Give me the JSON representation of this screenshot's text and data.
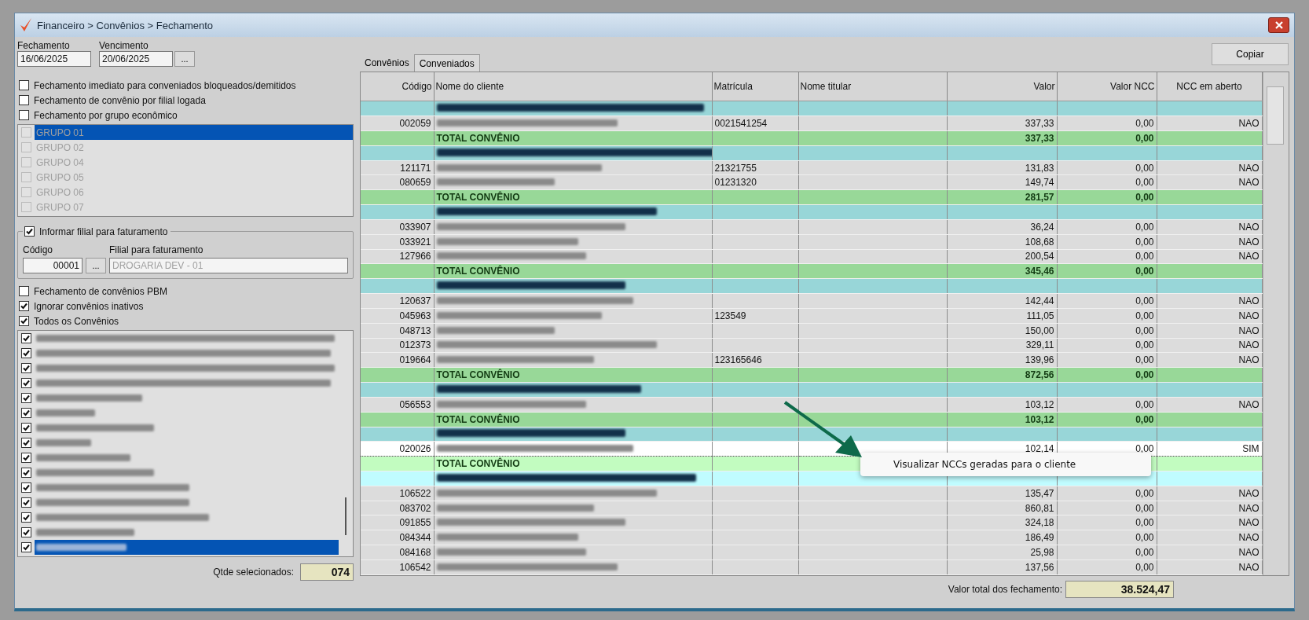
{
  "window": {
    "title": "Financeiro > Convênios > Fechamento"
  },
  "dates": {
    "fechamento_label": "Fechamento",
    "fechamento": "16/06/2025",
    "vencimento_label": "Vencimento",
    "vencimento": "20/06/2025",
    "picker": "..."
  },
  "options_top": [
    {
      "label": "Fechamento imediato para conveniados bloqueados/demitidos",
      "checked": false
    },
    {
      "label": "Fechamento de convênio por filial logada",
      "checked": false
    },
    {
      "label": "Fechamento por grupo econômico",
      "checked": false
    }
  ],
  "group_list": {
    "disabled": true,
    "items": [
      {
        "label": "GRUPO 01",
        "checked": false,
        "selected": true
      },
      {
        "label": "GRUPO 02",
        "checked": false,
        "selected": false
      },
      {
        "label": "GRUPO 04",
        "checked": false,
        "selected": false
      },
      {
        "label": "GRUPO 05",
        "checked": false,
        "selected": false
      },
      {
        "label": "GRUPO 06",
        "checked": false,
        "selected": false
      },
      {
        "label": "GRUPO 07",
        "checked": false,
        "selected": false
      }
    ]
  },
  "filial": {
    "label": "Informar filial para faturamento",
    "checked": true,
    "codigo_label": "Código",
    "codigo": "00001",
    "picker": "...",
    "filial_label": "Filial para faturamento",
    "filial": "DROGARIA DEV - 01"
  },
  "options_bottom": [
    {
      "label": "Fechamento de convênios PBM",
      "checked": false
    },
    {
      "label": "Ignorar convênios inativos",
      "checked": true
    },
    {
      "label": "Todos os Convênios",
      "checked": true
    }
  ],
  "convenios": [
    {
      "checked": true,
      "selected": false
    },
    {
      "checked": true,
      "selected": false
    },
    {
      "checked": true,
      "selected": false
    },
    {
      "checked": true,
      "selected": false
    },
    {
      "checked": true,
      "selected": false
    },
    {
      "checked": true,
      "selected": false
    },
    {
      "checked": true,
      "selected": false
    },
    {
      "checked": true,
      "selected": false
    },
    {
      "checked": true,
      "selected": false
    },
    {
      "checked": true,
      "selected": false
    },
    {
      "checked": true,
      "selected": false
    },
    {
      "checked": true,
      "selected": false
    },
    {
      "checked": true,
      "selected": false
    },
    {
      "checked": true,
      "selected": false
    },
    {
      "checked": true,
      "selected": true
    }
  ],
  "qtde": {
    "label": "Qtde selecionados:",
    "value": "074"
  },
  "tabs": [
    {
      "label": "Convênios",
      "selected": false
    },
    {
      "label": "Conveniados",
      "selected": true
    }
  ],
  "copy_button": "Copiar",
  "table": {
    "columns": [
      "Código",
      "Nome do cliente",
      "Matrícula",
      "Nome titular",
      "Valor",
      "Valor NCC",
      "NCC em aberto"
    ],
    "rows": [
      {
        "kind": "group",
        "highlighted": false
      },
      {
        "kind": "item",
        "codigo": "002059",
        "matricula": "0021541254",
        "valor": "337,33",
        "valor_ncc": "0,00",
        "ncc_aberto": "NAO",
        "selected": false
      },
      {
        "kind": "total",
        "label": "TOTAL CONVÊNIO",
        "valor": "337,33",
        "valor_ncc": "0,00",
        "highlighted": false
      },
      {
        "kind": "group",
        "highlighted": false
      },
      {
        "kind": "item",
        "codigo": "121171",
        "matricula": "21321755",
        "valor": "131,83",
        "valor_ncc": "0,00",
        "ncc_aberto": "NAO",
        "selected": false
      },
      {
        "kind": "item",
        "codigo": "080659",
        "matricula": "01231320",
        "valor": "149,74",
        "valor_ncc": "0,00",
        "ncc_aberto": "NAO",
        "selected": false
      },
      {
        "kind": "total",
        "label": "TOTAL CONVÊNIO",
        "valor": "281,57",
        "valor_ncc": "0,00",
        "highlighted": false
      },
      {
        "kind": "group",
        "highlighted": false
      },
      {
        "kind": "item",
        "codigo": "033907",
        "valor": "36,24",
        "valor_ncc": "0,00",
        "ncc_aberto": "NAO",
        "selected": false
      },
      {
        "kind": "item",
        "codigo": "033921",
        "valor": "108,68",
        "valor_ncc": "0,00",
        "ncc_aberto": "NAO",
        "selected": false
      },
      {
        "kind": "item",
        "codigo": "127966",
        "valor": "200,54",
        "valor_ncc": "0,00",
        "ncc_aberto": "NAO",
        "selected": false
      },
      {
        "kind": "total",
        "label": "TOTAL CONVÊNIO",
        "valor": "345,46",
        "valor_ncc": "0,00",
        "highlighted": false
      },
      {
        "kind": "group",
        "highlighted": false
      },
      {
        "kind": "item",
        "codigo": "120637",
        "valor": "142,44",
        "valor_ncc": "0,00",
        "ncc_aberto": "NAO",
        "selected": false
      },
      {
        "kind": "item",
        "codigo": "045963",
        "matricula": "123549",
        "valor": "111,05",
        "valor_ncc": "0,00",
        "ncc_aberto": "NAO",
        "selected": false
      },
      {
        "kind": "item",
        "codigo": "048713",
        "valor": "150,00",
        "valor_ncc": "0,00",
        "ncc_aberto": "NAO",
        "selected": false
      },
      {
        "kind": "item",
        "codigo": "012373",
        "valor": "329,11",
        "valor_ncc": "0,00",
        "ncc_aberto": "NAO",
        "selected": false
      },
      {
        "kind": "item",
        "codigo": "019664",
        "matricula": "123165646",
        "valor": "139,96",
        "valor_ncc": "0,00",
        "ncc_aberto": "NAO",
        "selected": false
      },
      {
        "kind": "total",
        "label": "TOTAL CONVÊNIO",
        "valor": "872,56",
        "valor_ncc": "0,00",
        "highlighted": false
      },
      {
        "kind": "group",
        "highlighted": false
      },
      {
        "kind": "item",
        "codigo": "056553",
        "valor": "103,12",
        "valor_ncc": "0,00",
        "ncc_aberto": "NAO",
        "selected": false
      },
      {
        "kind": "total",
        "label": "TOTAL CONVÊNIO",
        "valor": "103,12",
        "valor_ncc": "0,00",
        "highlighted": false
      },
      {
        "kind": "group",
        "highlighted": false
      },
      {
        "kind": "item",
        "codigo": "020026",
        "valor": "102,14",
        "valor_ncc": "0,00",
        "ncc_aberto": "SIM",
        "selected": true
      },
      {
        "kind": "total",
        "label": "TOTAL CONVÊNIO",
        "highlighted": true
      },
      {
        "kind": "group",
        "highlighted": true
      },
      {
        "kind": "item",
        "codigo": "106522",
        "valor": "135,47",
        "valor_ncc": "0,00",
        "ncc_aberto": "NAO",
        "selected": false
      },
      {
        "kind": "item",
        "codigo": "083702",
        "valor": "860,81",
        "valor_ncc": "0,00",
        "ncc_aberto": "NAO",
        "selected": false
      },
      {
        "kind": "item",
        "codigo": "091855",
        "valor": "324,18",
        "valor_ncc": "0,00",
        "ncc_aberto": "NAO",
        "selected": false
      },
      {
        "kind": "item",
        "codigo": "084344",
        "valor": "186,49",
        "valor_ncc": "0,00",
        "ncc_aberto": "NAO",
        "selected": false
      },
      {
        "kind": "item",
        "codigo": "084168",
        "valor": "25,98",
        "valor_ncc": "0,00",
        "ncc_aberto": "NAO",
        "selected": false
      },
      {
        "kind": "item",
        "codigo": "106542",
        "valor": "137,56",
        "valor_ncc": "0,00",
        "ncc_aberto": "NAO",
        "selected": false
      }
    ]
  },
  "context_menu": {
    "items": [
      "Visualizar NCCs geradas para o cliente"
    ]
  },
  "total": {
    "label": "Valor total dos fechamento:",
    "value": "38.524,47"
  }
}
